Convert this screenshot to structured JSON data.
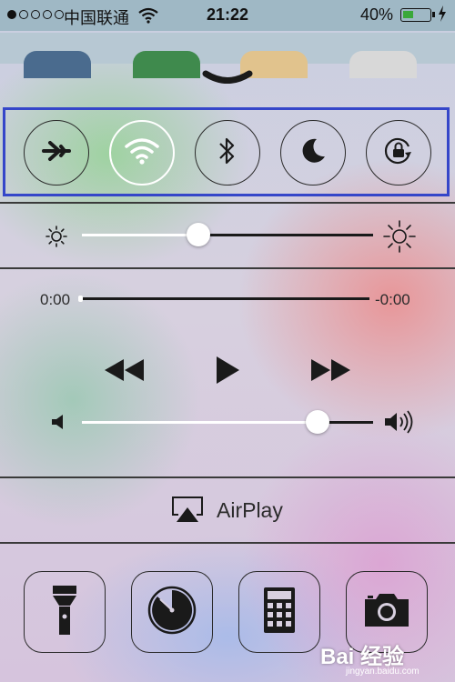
{
  "status_bar": {
    "carrier": "中国联通",
    "time": "21:22",
    "battery_percent": "40%",
    "battery_level": 0.4,
    "signal_bars_filled": 1,
    "signal_bars_total": 5
  },
  "toggles": [
    {
      "name": "airplane-mode",
      "icon": "airplane-icon",
      "active": false
    },
    {
      "name": "wifi",
      "icon": "wifi-icon",
      "active": true
    },
    {
      "name": "bluetooth",
      "icon": "bluetooth-icon",
      "active": false
    },
    {
      "name": "do-not-disturb",
      "icon": "moon-icon",
      "active": false
    },
    {
      "name": "rotation-lock",
      "icon": "rotation-lock-icon",
      "active": false
    }
  ],
  "brightness": {
    "level": 0.4
  },
  "media": {
    "elapsed": "0:00",
    "remaining": "-0:00",
    "progress": 0,
    "volume": 0.81
  },
  "airplay": {
    "label": "AirPlay"
  },
  "shortcuts": [
    {
      "name": "flashlight",
      "icon": "flashlight-icon"
    },
    {
      "name": "timer",
      "icon": "timer-icon"
    },
    {
      "name": "calculator",
      "icon": "calculator-icon"
    },
    {
      "name": "camera",
      "icon": "camera-icon"
    }
  ],
  "watermark": {
    "text": "Bai 经验",
    "url_text": "jingyan.baidu.com"
  },
  "colors": {
    "highlight_box": "#3546c9",
    "battery_fill": "#3aa83a"
  }
}
